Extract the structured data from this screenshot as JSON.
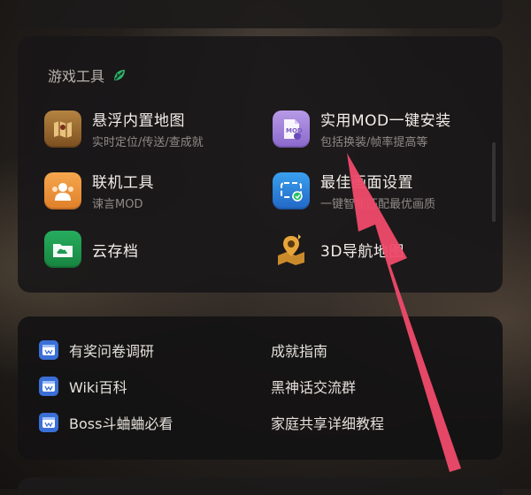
{
  "section": {
    "title": "游戏工具",
    "icon": "leaf-icon"
  },
  "tools": [
    {
      "name": "悬浮内置地图",
      "desc": "实时定位/传送/查成就",
      "icon": "map-icon",
      "color": "#9c6b2e"
    },
    {
      "name": "实用MOD一键安装",
      "desc": "包括换装/帧率提高等",
      "icon": "mod-file-icon",
      "color": "#9a7bd6"
    },
    {
      "name": "联机工具",
      "desc": "谏言MOD",
      "icon": "multiplayer-icon",
      "color": "#e8923a"
    },
    {
      "name": "最佳画面设置",
      "desc": "一键智能匹配最优画质",
      "icon": "screen-settings-icon",
      "color": "#2f8fe0"
    },
    {
      "name": "云存档",
      "desc": "",
      "icon": "cloud-folder-icon",
      "color": "#1e9a52"
    },
    {
      "name": "3D导航地图",
      "desc": "",
      "icon": "3d-map-pin-icon",
      "color": "#c98a2c"
    }
  ],
  "links": [
    {
      "label": "有奖问卷调研",
      "icon": "web-link-icon"
    },
    {
      "label": "成就指南"
    },
    {
      "label": "Wiki百科",
      "icon": "web-link-icon"
    },
    {
      "label": "黑神话交流群"
    },
    {
      "label": "Boss斗蛐蛐必看",
      "icon": "web-link-icon"
    },
    {
      "label": "家庭共享详细教程"
    }
  ],
  "annotation": {
    "arrow_color": "#f04a6a"
  }
}
